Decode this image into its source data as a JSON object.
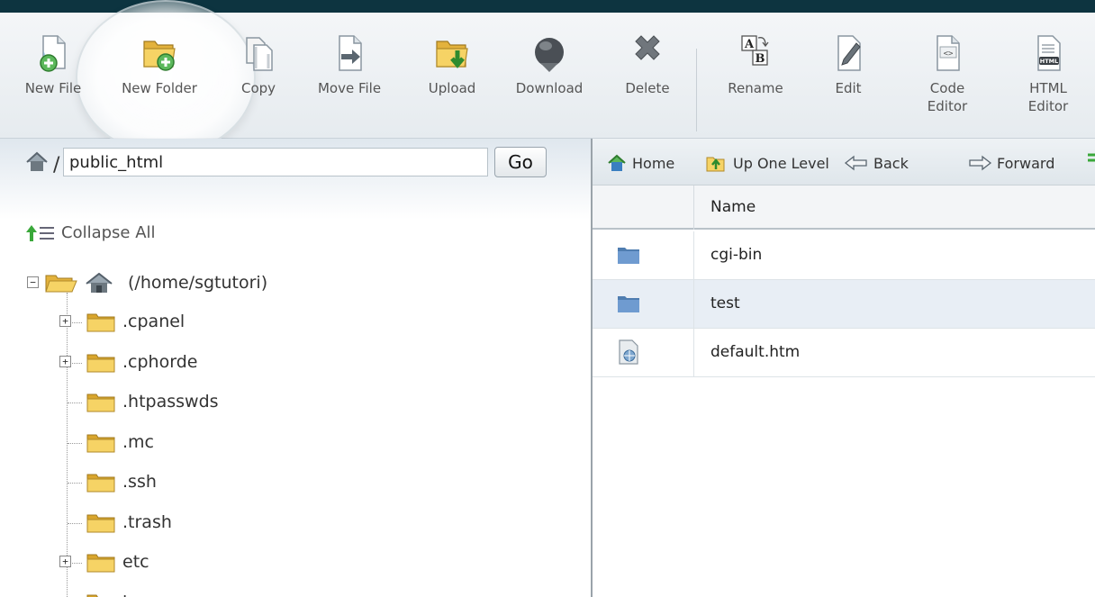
{
  "toolbar": {
    "items": [
      {
        "label": "New File",
        "icon": "new-file-icon"
      },
      {
        "label": "New Folder",
        "icon": "new-folder-icon"
      },
      {
        "label": "Copy",
        "icon": "copy-icon"
      },
      {
        "label": "Move File",
        "icon": "move-file-icon"
      },
      {
        "label": "Upload",
        "icon": "upload-icon"
      },
      {
        "label": "Download",
        "icon": "download-icon"
      },
      {
        "label": "Delete",
        "icon": "delete-icon"
      },
      {
        "label": "Rename",
        "icon": "rename-icon"
      },
      {
        "label": "Edit",
        "icon": "edit-icon"
      },
      {
        "label": "Code Editor",
        "icon": "code-editor-icon"
      },
      {
        "label": "HTML Editor",
        "icon": "html-editor-icon"
      }
    ]
  },
  "path": {
    "value": "public_html",
    "go_label": "Go"
  },
  "tree": {
    "collapse_label": "Collapse All",
    "root_label": "(/home/sgtutori)",
    "items": [
      {
        "label": ".cpanel",
        "expandable": true
      },
      {
        "label": ".cphorde",
        "expandable": true
      },
      {
        "label": ".htpasswds",
        "expandable": false
      },
      {
        "label": ".mc",
        "expandable": false
      },
      {
        "label": ".ssh",
        "expandable": false
      },
      {
        "label": ".trash",
        "expandable": false
      },
      {
        "label": "etc",
        "expandable": true
      },
      {
        "label": "logs",
        "expandable": false
      }
    ]
  },
  "nav": {
    "home": "Home",
    "up": "Up One Level",
    "back": "Back",
    "forward": "Forward"
  },
  "files": {
    "header_name": "Name",
    "rows": [
      {
        "name": "cgi-bin",
        "type": "folder"
      },
      {
        "name": "test",
        "type": "folder"
      },
      {
        "name": "default.htm",
        "type": "file"
      }
    ]
  },
  "colors": {
    "topbar": "#0d3440",
    "folder_yellow": "#f2c94c",
    "folder_blue": "#5b87b8",
    "selected_row": "#e8eef5"
  }
}
